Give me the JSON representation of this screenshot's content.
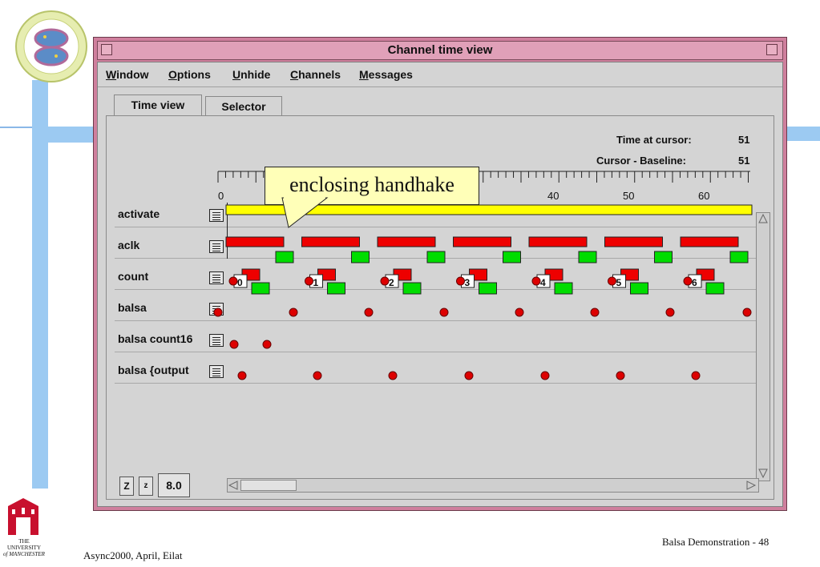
{
  "window": {
    "title": "Channel time view"
  },
  "menu": [
    {
      "label": "Window",
      "mnemonic": "W",
      "rest": "indow"
    },
    {
      "label": "Options",
      "mnemonic": "O",
      "rest": "ptions"
    },
    {
      "label": "Unhide",
      "mnemonic": "U",
      "rest": "nhide"
    },
    {
      "label": "Channels",
      "mnemonic": "C",
      "rest": "hannels"
    },
    {
      "label": "Messages",
      "mnemonic": "M",
      "rest": "essages"
    }
  ],
  "tabs": [
    {
      "label": "Time view",
      "active": true
    },
    {
      "label": "Selector",
      "active": false
    }
  ],
  "cursor_info": {
    "time_label": "Time at cursor:",
    "time_value": "51",
    "baseline_label": "Cursor - Baseline:",
    "baseline_value": "51"
  },
  "ruler": {
    "labels": [
      "0",
      "40",
      "50",
      "60"
    ]
  },
  "rows": [
    {
      "label": "activate"
    },
    {
      "label": "aclk"
    },
    {
      "label": "count"
    },
    {
      "label": "balsa"
    },
    {
      "label": "balsa count16"
    },
    {
      "label": "balsa {output"
    }
  ],
  "count_values": [
    "0",
    "1",
    "2",
    "3",
    "4",
    "5",
    "6"
  ],
  "zoom": {
    "zoom_out_label": "Z",
    "zoom_in_label": "z",
    "zoom_value": "8.0"
  },
  "callout": {
    "text": "enclosing handhake"
  },
  "colors": {
    "window_frame": "#cf7f9d",
    "activate": "#ffff00",
    "request": "#ee0000",
    "acknowledge": "#00dd00",
    "dot": "#dd0000"
  },
  "footer": {
    "left": "Async2000, April, Eilat",
    "right": "Balsa Demonstration - 48",
    "university_line1": "THE UNIVERSITY",
    "university_line2": "of MANCHESTER"
  }
}
